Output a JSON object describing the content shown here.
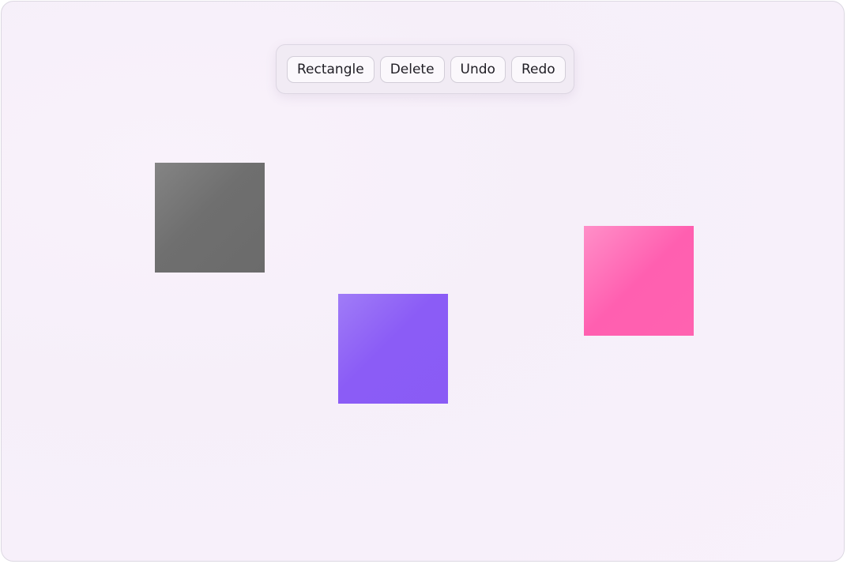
{
  "toolbar": {
    "rectangle_label": "Rectangle",
    "delete_label": "Delete",
    "undo_label": "Undo",
    "redo_label": "Redo"
  },
  "shapes": [
    {
      "kind": "rectangle",
      "color": "#6f6f6f"
    },
    {
      "kind": "rectangle",
      "color": "#8b5cf6"
    },
    {
      "kind": "rectangle",
      "color": "#ff5fb0"
    }
  ]
}
